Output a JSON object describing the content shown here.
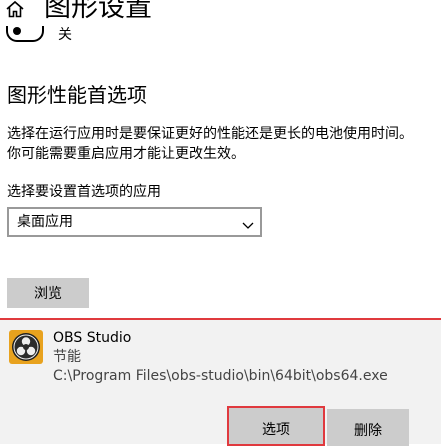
{
  "header": {
    "title": "图形设置",
    "home_icon": "home-icon"
  },
  "toggle": {
    "label": "关",
    "state": "off"
  },
  "section": {
    "title": "图形性能首选项",
    "description_line1": "选择在运行应用时是要保证更好的性能还是更长的电池使用时间。",
    "description_line2": "你可能需要重启应用才能让更改生效。"
  },
  "app_select": {
    "label": "选择要设置首选项的应用",
    "selected": "桌面应用",
    "icon": "chevron-down-icon"
  },
  "browse_button": {
    "label": "浏览"
  },
  "app_entry": {
    "name": "OBS Studio",
    "preference": "节能",
    "path": "C:\\Program Files\\obs-studio\\bin\\64bit\\obs64.exe",
    "icon": "obs-studio-icon"
  },
  "buttons": {
    "options_label": "选项",
    "delete_label": "删除"
  },
  "colors": {
    "accent_red": "#e0393e",
    "button_gray": "#cccccc",
    "panel_bg": "#f2f2f2"
  }
}
